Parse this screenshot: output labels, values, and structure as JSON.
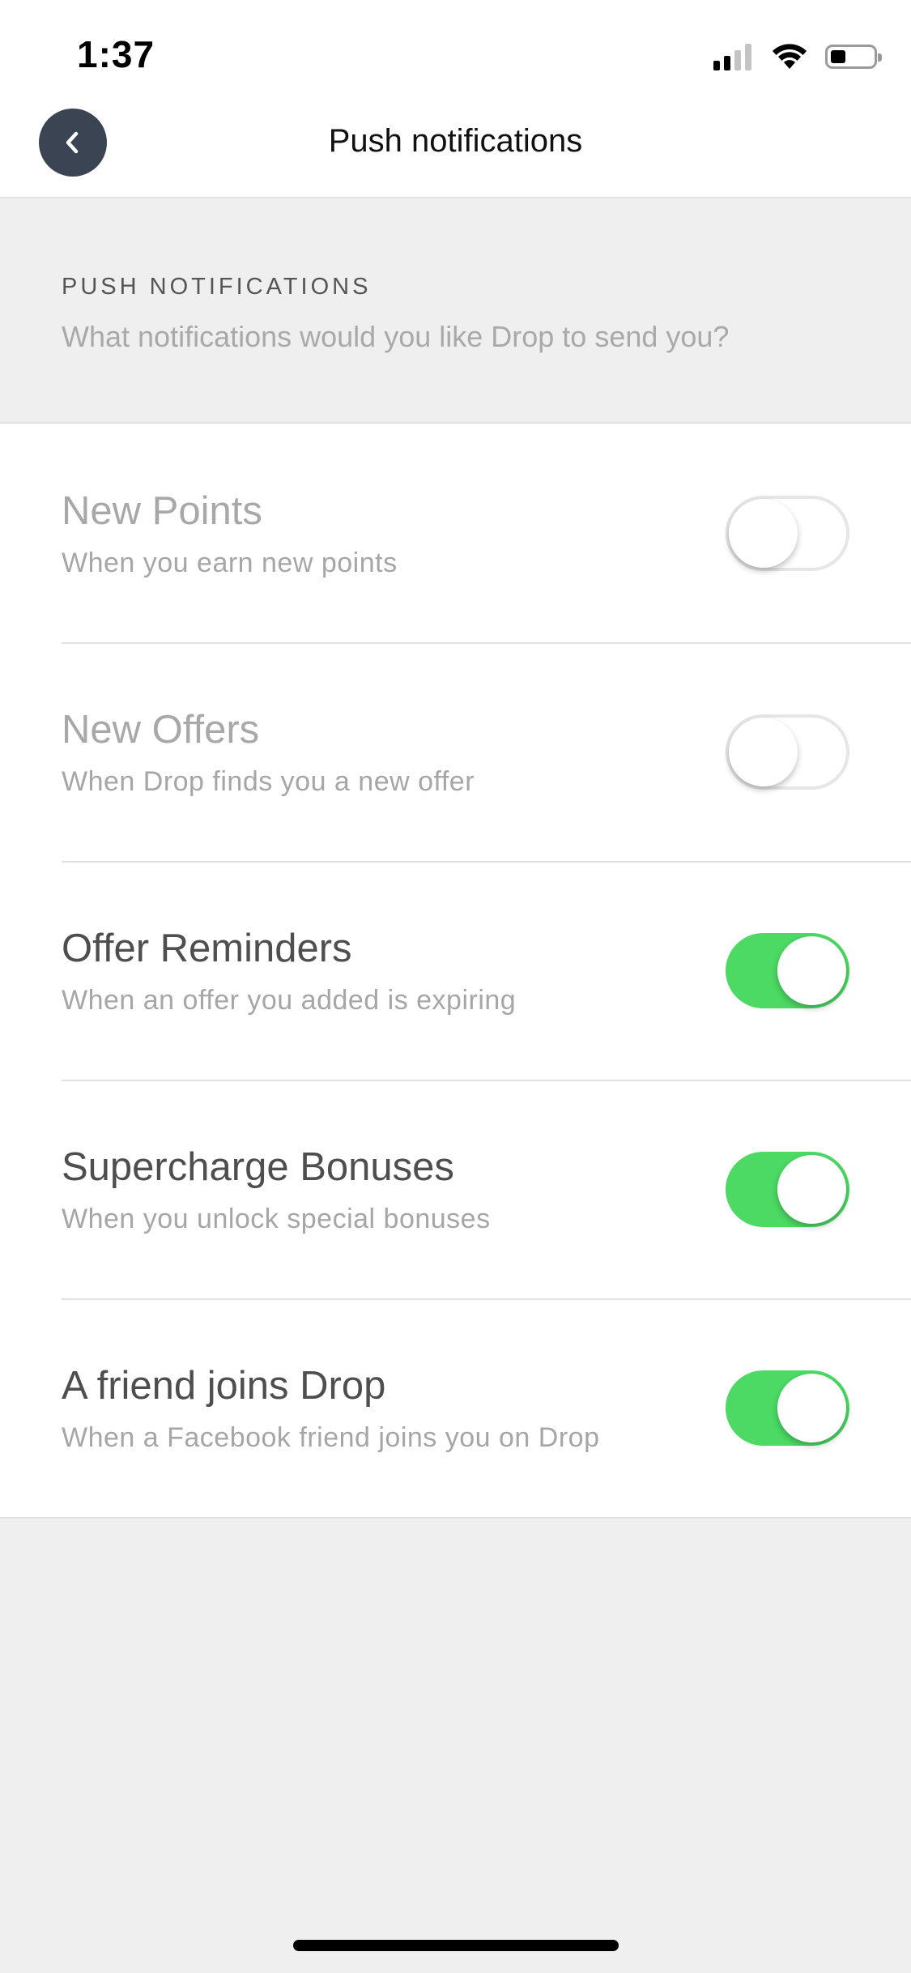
{
  "status_bar": {
    "time": "1:37",
    "icons": [
      "signal-icon",
      "wifi-icon",
      "battery-icon"
    ]
  },
  "nav": {
    "title": "Push notifications",
    "back_icon": "chevron-left-icon"
  },
  "section": {
    "title": "PUSH NOTIFICATIONS",
    "description": "What notifications would you like Drop to send you?"
  },
  "settings": [
    {
      "title": "New Points",
      "subtitle": "When you earn new points",
      "enabled": false
    },
    {
      "title": "New Offers",
      "subtitle": "When Drop finds you a new offer",
      "enabled": false
    },
    {
      "title": "Offer Reminders",
      "subtitle": "When an offer you added is expiring",
      "enabled": true
    },
    {
      "title": "Supercharge Bonuses",
      "subtitle": "When you unlock special bonuses",
      "enabled": true
    },
    {
      "title": "A friend joins Drop",
      "subtitle": "When a Facebook friend joins you on Drop",
      "enabled": true
    }
  ],
  "colors": {
    "toggle_on": "#4cd964",
    "back_button": "#3a4453",
    "background": "#efefef"
  }
}
